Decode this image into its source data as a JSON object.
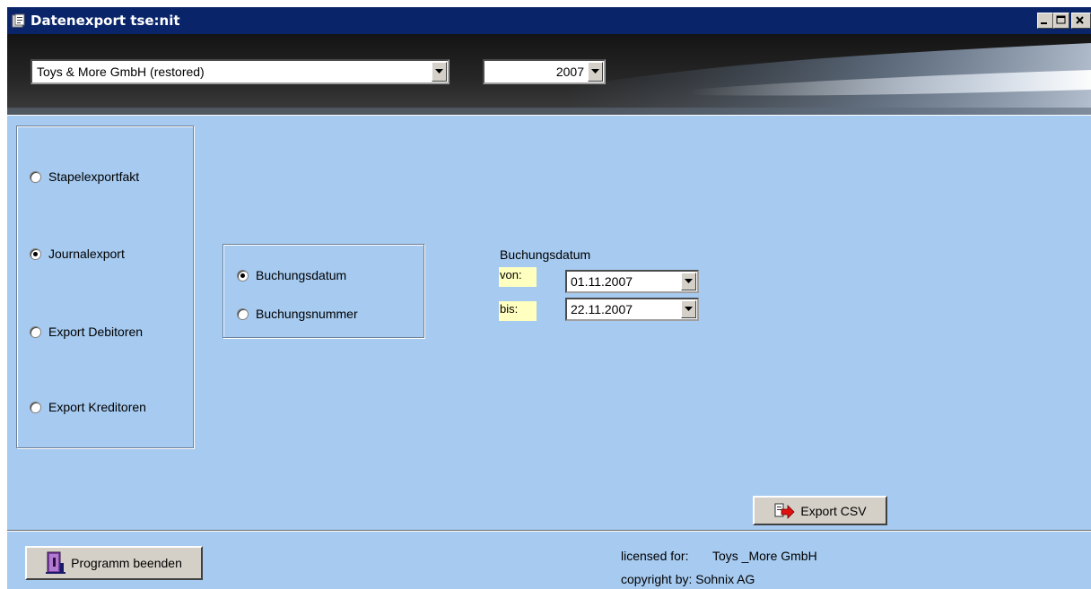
{
  "window": {
    "title": "Datenexport  tse:nit",
    "controls": [
      "minimize-icon",
      "maximize-icon",
      "close-icon"
    ]
  },
  "header": {
    "company_select": {
      "value": "Toys & More GmbH (restored)"
    },
    "year_select": {
      "value": "2007"
    }
  },
  "export_options": [
    {
      "label": "Stapelexportfakt",
      "checked": false
    },
    {
      "label": "Journalexport",
      "checked": true
    },
    {
      "label": "Export Debitoren",
      "checked": false
    },
    {
      "label": "Export Kreditoren",
      "checked": false
    }
  ],
  "filter_mode": [
    {
      "label": "Buchungsdatum",
      "checked": true
    },
    {
      "label": "Buchungsnummer",
      "checked": false
    }
  ],
  "date_range": {
    "heading": "Buchungsdatum",
    "from_label": "von:",
    "from_value": "01.11.2007",
    "to_label": "bis:",
    "to_value": "22.11.2007"
  },
  "export_button": {
    "label": "Export CSV",
    "icon": "export-arrow-icon"
  },
  "footer": {
    "exit_button": {
      "label": "Programm beenden",
      "icon": "exit-door-icon"
    },
    "licensed_label": "licensed for:",
    "licensed_value": "Toys _More GmbH",
    "copyright": "copyright by: Sohnix AG"
  },
  "colors": {
    "form_background": "#a6caf0",
    "titlebar": "#0a246a",
    "label_highlight": "#ffffc0",
    "button_face": "#d4d0c8"
  }
}
